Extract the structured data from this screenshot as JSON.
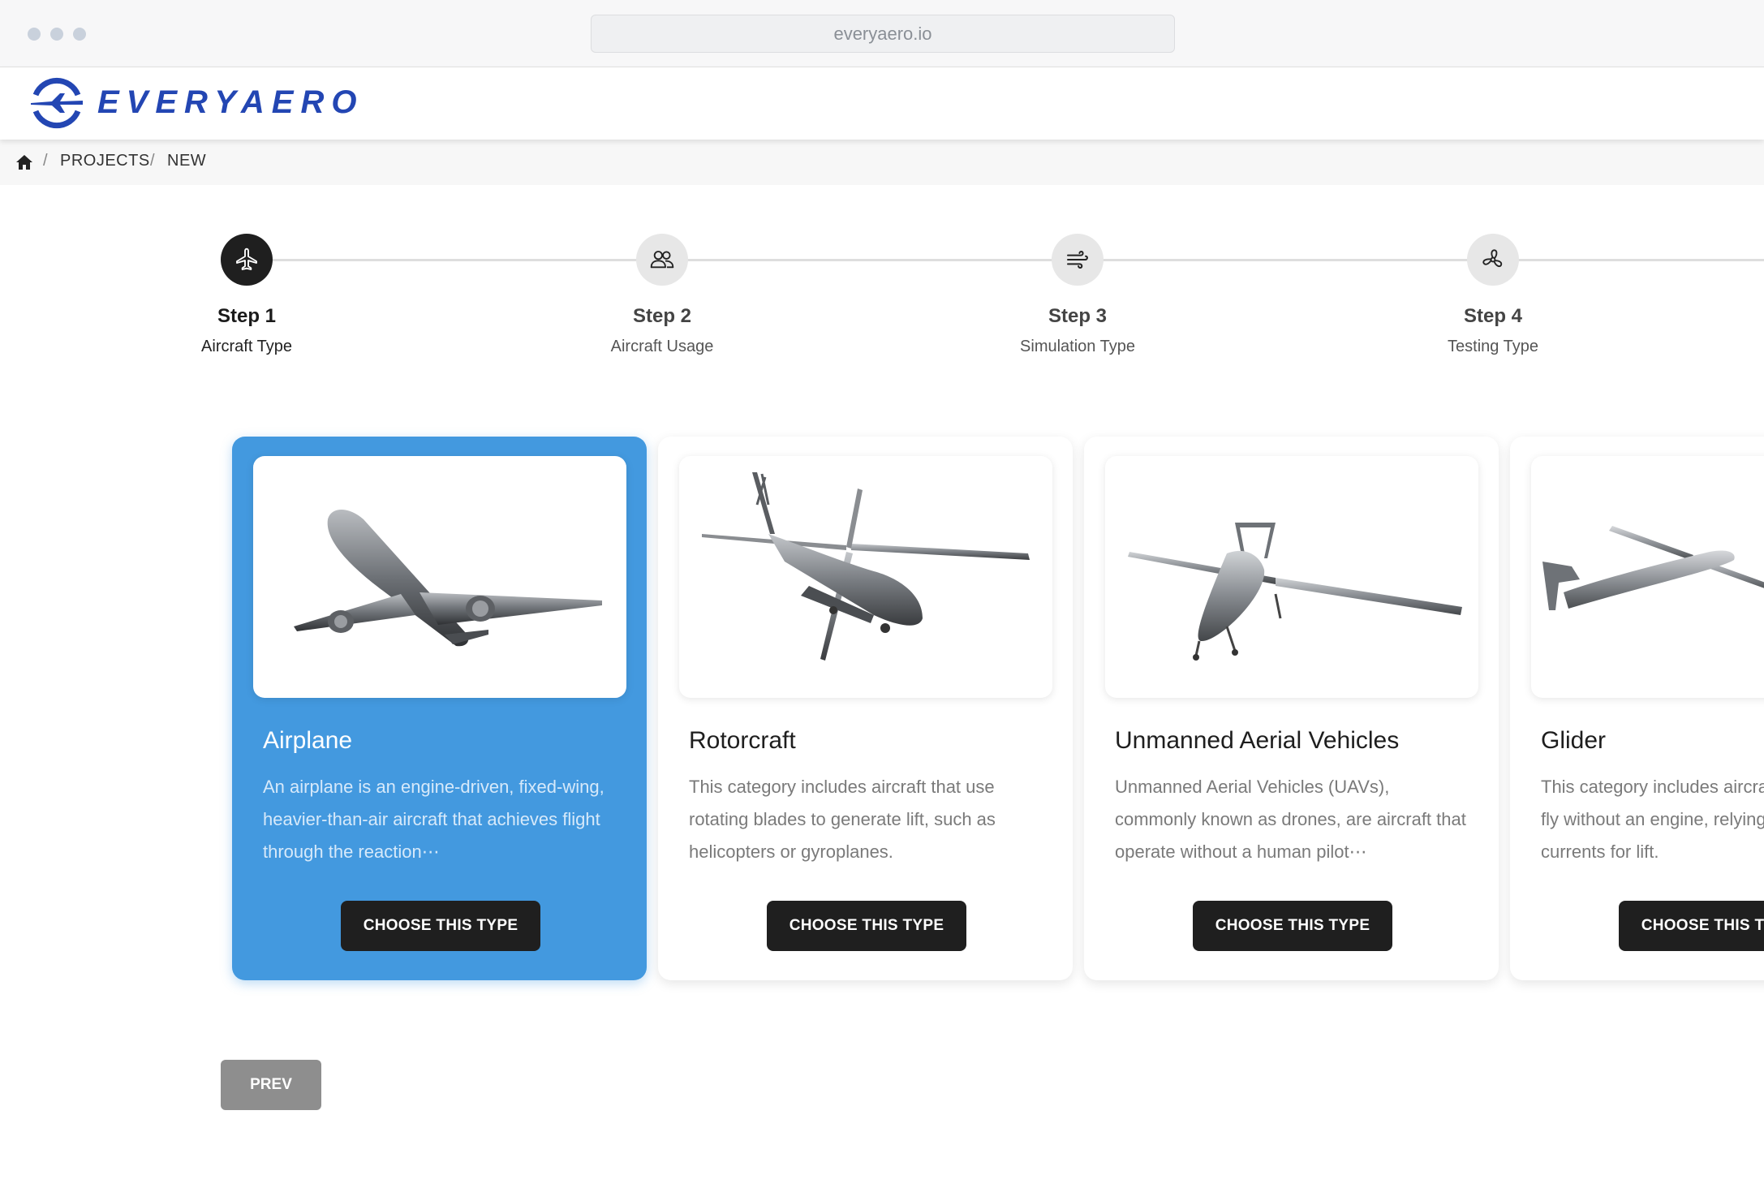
{
  "browser": {
    "url": "everyaero.io"
  },
  "header": {
    "logo_text": "EVERYAERO",
    "brand_color": "#2346b3"
  },
  "breadcrumb": {
    "items": [
      "PROJECTS",
      "NEW"
    ],
    "separator": "/"
  },
  "stepper": {
    "steps": [
      {
        "title": "Step 1",
        "label": "Aircraft Type",
        "icon": "airplane-icon",
        "active": true
      },
      {
        "title": "Step 2",
        "label": "Aircraft Usage",
        "icon": "users-icon",
        "active": false
      },
      {
        "title": "Step 3",
        "label": "Simulation Type",
        "icon": "wind-icon",
        "active": false
      },
      {
        "title": "Step 4",
        "label": "Testing Type",
        "icon": "fan-icon",
        "active": false
      }
    ]
  },
  "cards": [
    {
      "title": "Airplane",
      "description": "An airplane is an engine-driven, fixed-wing, heavier-than-air aircraft that achieves flight through the reaction⋯",
      "button": "CHOOSE THIS TYPE",
      "selected": true
    },
    {
      "title": "Rotorcraft",
      "description": "This category includes aircraft that use rotating blades to generate lift, such as helicopters or gyroplanes.",
      "button": "CHOOSE THIS TYPE",
      "selected": false
    },
    {
      "title": "Unmanned Aerial Vehicles",
      "description": "Unmanned Aerial Vehicles (UAVs), commonly known as drones, are aircraft that operate without a human pilot⋯",
      "button": "CHOOSE THIS TYPE",
      "selected": false
    },
    {
      "title": "Glider",
      "description": "This category includes aircraft designed to fly without an engine, relying on natural air currents for lift.",
      "button": "CHOOSE THIS TYPE",
      "selected": false
    }
  ],
  "footer": {
    "prev_label": "PREV"
  },
  "colors": {
    "selected_card": "#4399df",
    "button_dark": "#1f1f1f",
    "prev_button": "#8e8e8e"
  }
}
